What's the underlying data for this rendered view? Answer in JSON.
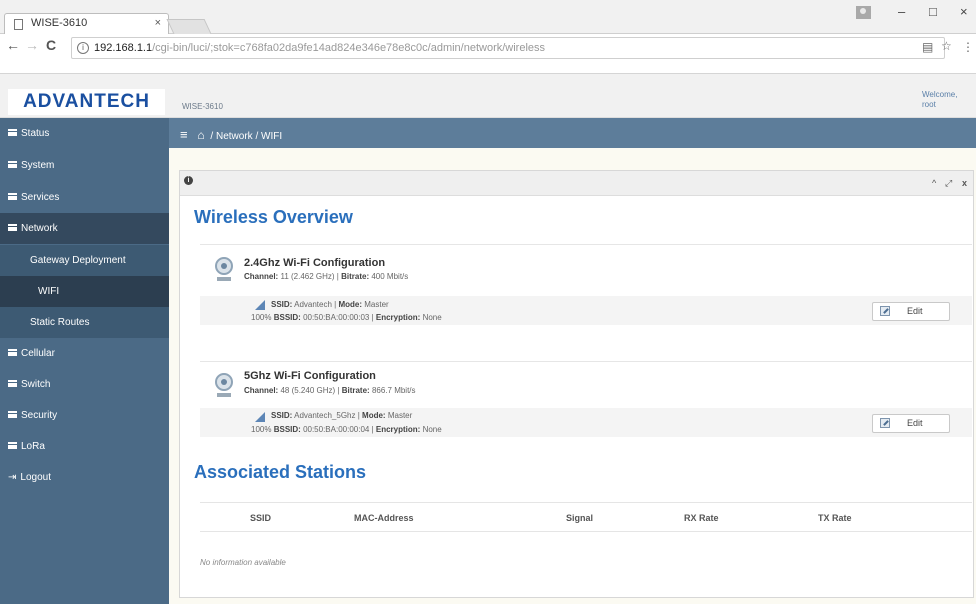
{
  "browser": {
    "tab_title": "WISE-3610",
    "tab_close": "×",
    "url_host": "192.168.1.1",
    "url_path": "/cgi-bin/luci/;stok=c768fa02da9fe14ad824e346e78e8c0c/admin/network/wireless",
    "window_controls": {
      "minimize": "–",
      "maximize": "□",
      "close": "×"
    },
    "nav": {
      "back": "←",
      "forward": "→",
      "reload": "C"
    }
  },
  "header": {
    "logo": "ADVANTECH",
    "device_name": "WISE-3610",
    "welcome_line1": "Welcome,",
    "welcome_line2": "root"
  },
  "sidebar": {
    "items": [
      {
        "label": "Status"
      },
      {
        "label": "System"
      },
      {
        "label": "Services"
      },
      {
        "label": "Network"
      },
      {
        "label": "Gateway Deployment"
      },
      {
        "label": "WIFI"
      },
      {
        "label": "Static Routes"
      },
      {
        "label": "Cellular"
      },
      {
        "label": "Switch"
      },
      {
        "label": "Security"
      },
      {
        "label": "LoRa"
      },
      {
        "label": "Logout"
      }
    ]
  },
  "breadcrumb": {
    "menu_icon": "≡",
    "home_icon": "home-icon",
    "sep": "/",
    "network": "Network",
    "wifi": "WIFI"
  },
  "panel": {
    "info": "i",
    "controls": {
      "collapse": "^",
      "expand": "⤢",
      "close": "x"
    }
  },
  "overview": {
    "title": "Wireless Overview",
    "radios": [
      {
        "title": "2.4Ghz Wi-Fi Configuration",
        "channel_label": "Channel:",
        "channel": "11 (2.462 GHz)",
        "bitrate_label": "Bitrate:",
        "bitrate": "400 Mbit/s",
        "ssid_label": "SSID:",
        "ssid": "Advantech",
        "mode_label": "Mode:",
        "mode": "Master",
        "signal": "100%",
        "bssid_label": "BSSID:",
        "bssid": "00:50:BA:00:00:03",
        "encryption_label": "Encryption:",
        "encryption": "None",
        "edit": "Edit"
      },
      {
        "title": "5Ghz Wi-Fi Configuration",
        "channel_label": "Channel:",
        "channel": "48 (5.240 GHz)",
        "bitrate_label": "Bitrate:",
        "bitrate": "866.7 Mbit/s",
        "ssid_label": "SSID:",
        "ssid": "Advantech_5Ghz",
        "mode_label": "Mode:",
        "mode": "Master",
        "signal": "100%",
        "bssid_label": "BSSID:",
        "bssid": "00:50:BA:00:00:04",
        "encryption_label": "Encryption:",
        "encryption": "None",
        "edit": "Edit"
      }
    ]
  },
  "stations": {
    "title": "Associated Stations",
    "columns": [
      "SSID",
      "MAC-Address",
      "Signal",
      "RX Rate",
      "TX Rate"
    ],
    "empty": "No information available"
  }
}
